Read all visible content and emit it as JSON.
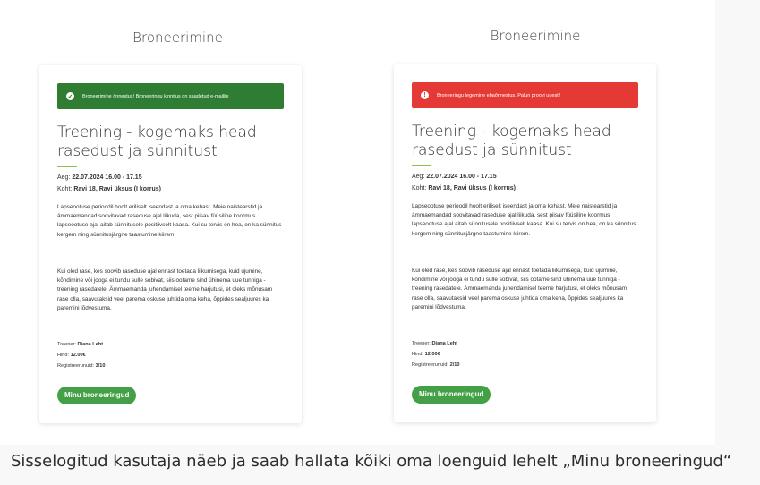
{
  "left": {
    "heading": "Broneerimine",
    "alert_text": "Broneerimine õnnestus! Broneeringu kinnitus on saadetud e-mailile",
    "alert_icon": "check-circle-icon",
    "title": "Treening - kogemaks head rasedust ja sünnitust",
    "time_label": "Aeg:",
    "time_value": "22.07.2024 16.00 - 17.15",
    "place_label": "Koht:",
    "place_value": "Ravi 18, Ravi üksus (I korrus)",
    "para1": "Lapseootuse perioodil hoolt eriliselt iseendast ja oma kehast. Meie naistearstid ja ämmaemandad soovitavad raseduse ajal liikuda, sest piisav füüsiline koormus lapseootuse ajal aitab sünnitusele positiivselt kaasa. Kui su tervis on hea, on ka sünnitus kergem ning sünnitusjärgne taastumine kiirem.",
    "para2": "Kui oled rase, kes soovib raseduse ajal ennast toetada liikumisega, kuid ujumine, kõndimine või jooga ei tundu sulle sobivat, siis ootame sind ühinema uue tunniga - treening rasedatele. Ämmaemanda juhendamisel teeme harjutusi, et oleks mõnusam rase olla, saavutaksid veel parema oskuse juhtida oma keha, õppides sealjuures ka paremini lõdvestuma.",
    "trainer_label": "Treener:",
    "trainer_value": "Diana Leht",
    "price_label": "Hind:",
    "price_value": "12.00€",
    "reg_label": "Registreerunuid:",
    "reg_value": "3/10",
    "button": "Minu broneeringud"
  },
  "right": {
    "heading": "Broneerimine",
    "alert_text": "Broneeringu tegemine ebaõnnestus. Palun proovi uuesti!",
    "alert_icon": "error-circle-icon",
    "title": "Treening - kogemaks head rasedust ja sünnitust",
    "time_label": "Aeg:",
    "time_value": "22.07.2024 16.00 - 17.15",
    "place_label": "Koht:",
    "place_value": "Ravi 18, Ravi üksus (I korrus)",
    "para1": "Lapseootuse perioodil hoolt eriliselt iseendast ja oma kehast. Meie naistearstid ja ämmaemandad soovitavad raseduse ajal liikuda, sest piisav füüsiline koormus lapseootuse ajal aitab sünnitusele positiivselt kaasa. Kui su tervis on hea, on ka sünnitus kergem ning sünnitusjärgne taastumine kiirem.",
    "para2": "Kui oled rase, kes soovib raseduse ajal ennast toetada liikumisega, kuid ujumine, kõndimine või jooga ei tundu sulle sobivat, siis ootame sind ühinema uue tunniga - treening rasedatele. Ämmaemanda juhendamisel teeme harjutusi, et oleks mõnusam rase olla, saavutaksid veel parema oskuse juhtida oma keha, õppides sealjuures ka paremini lõdvestuma.",
    "trainer_label": "Treener:",
    "trainer_value": "Diana Leht",
    "price_label": "Hind:",
    "price_value": "12.00€",
    "reg_label": "Registreerunuid:",
    "reg_value": "2/10",
    "button": "Minu broneeringud"
  },
  "caption": "Sisselogitud kasutaja näeb ja saab hallata kõiki oma loenguid lehelt „Minu broneeringud“",
  "colors": {
    "success": "#2e7d32",
    "error": "#e53935",
    "button": "#43a047",
    "accent_line": "#8bc34a"
  }
}
